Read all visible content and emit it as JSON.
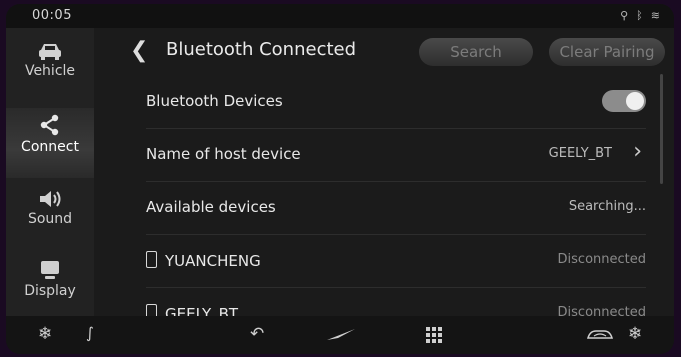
{
  "status": {
    "time": "00:05"
  },
  "sidebar": {
    "items": [
      {
        "label": "Vehicle",
        "icon": "car-icon"
      },
      {
        "label": "Connect",
        "icon": "share-icon",
        "active": true
      },
      {
        "label": "Sound",
        "icon": "speaker-icon"
      },
      {
        "label": "Display",
        "icon": "monitor-icon"
      }
    ]
  },
  "header": {
    "title": "Bluetooth Connected",
    "search_label": "Search",
    "clear_label": "Clear Pairing"
  },
  "rows": {
    "bluetooth": {
      "label": "Bluetooth Devices",
      "enabled": true
    },
    "host": {
      "label": "Name of host device",
      "value": "GEELY_BT"
    },
    "available": {
      "label": "Available devices",
      "value": "Searching..."
    },
    "device1": {
      "label": "YUANCHENG",
      "value": "Disconnected"
    },
    "device2": {
      "label": "GEELY_BT",
      "value": "Disconnected"
    }
  }
}
